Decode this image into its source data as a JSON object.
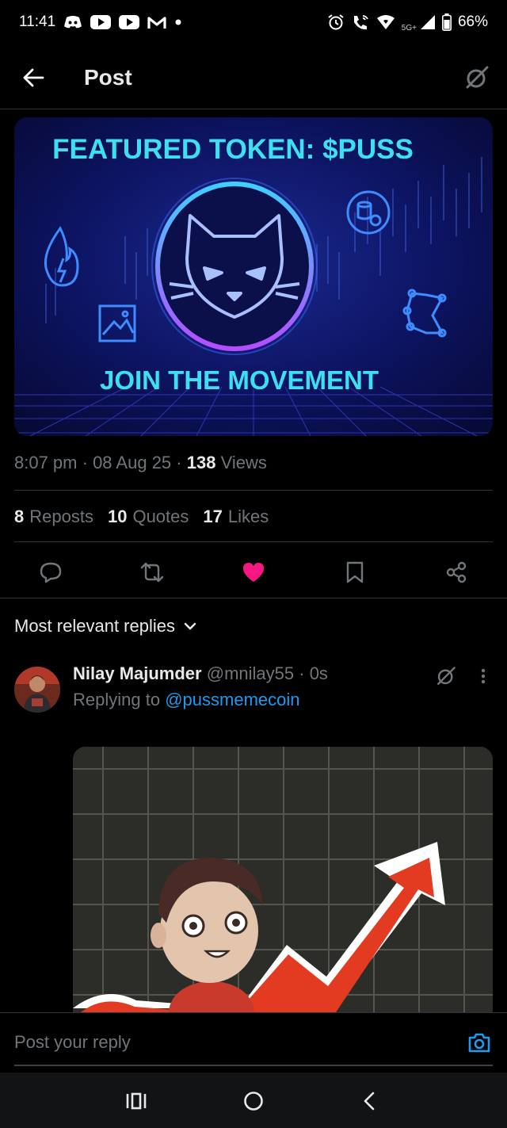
{
  "status_bar": {
    "time": "11:41",
    "network": "5G+",
    "battery": "66%",
    "left_icons": [
      "discord-icon",
      "youtube-icon",
      "youtube-icon",
      "gmail-icon",
      "dot-icon"
    ],
    "right_icons": [
      "alarm-icon",
      "wifi-calling-icon",
      "wifi-icon",
      "signal-icon",
      "battery-icon"
    ]
  },
  "header": {
    "title": "Post"
  },
  "post": {
    "image": {
      "headline": "FEATURED TOKEN: $PUSS",
      "tagline": "JOIN THE MOVEMENT"
    },
    "time": "8:07 pm",
    "date": "08 Aug 25",
    "views_count": "138",
    "views_label": "Views",
    "stats": {
      "reposts_count": "8",
      "reposts_label": "Reposts",
      "quotes_count": "10",
      "quotes_label": "Quotes",
      "likes_count": "17",
      "likes_label": "Likes"
    },
    "liked": true,
    "colors": {
      "like": "#f91880",
      "link": "#1d9bf0",
      "accent_neon": "#3de0f0"
    }
  },
  "replies": {
    "sort_label": "Most relevant replies",
    "items": [
      {
        "name": "Nilay Majumder",
        "handle": "@mnilay55",
        "time": "0s",
        "replying_prefix": "Replying to",
        "replying_to": "@pussmemecoin"
      }
    ]
  },
  "compose": {
    "placeholder": "Post your reply"
  }
}
